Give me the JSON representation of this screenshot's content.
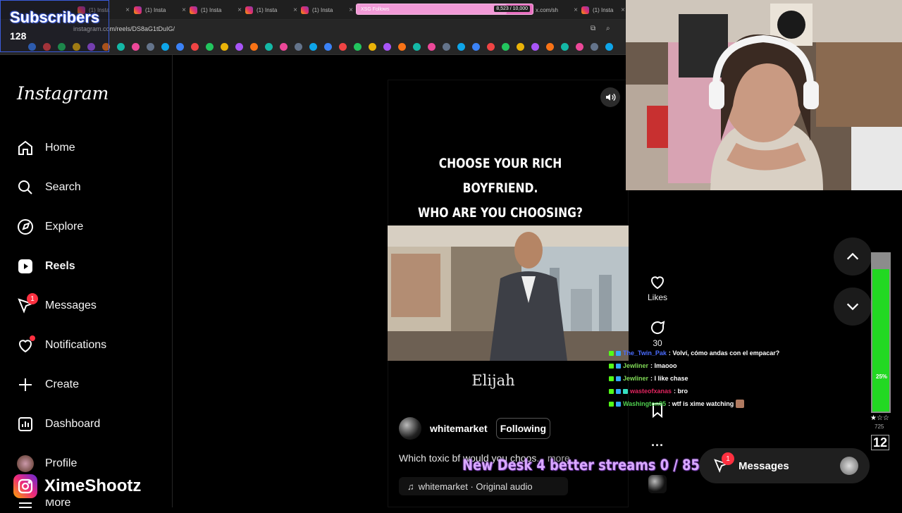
{
  "browser": {
    "tabs": [
      {
        "label": "(1) Insta"
      },
      {
        "label": "(1) Insta"
      },
      {
        "label": "(1) Insta"
      },
      {
        "label": "(1) Insta"
      },
      {
        "label": "(1) Insta"
      },
      {
        "label": "(1) Insta"
      },
      {
        "label": "(1) Insta"
      }
    ],
    "progress_tab": {
      "label": "XSG Follows",
      "count": "8,523 / 10,000",
      "fraction": 0.8523
    },
    "url": "instagram.com/reels/DS8aG1tDuIG/",
    "partial_tab_text": "x.com/sh"
  },
  "subscribers": {
    "title": "Subscribers",
    "count": "128"
  },
  "sidebar": {
    "logo": "Instagram",
    "items": [
      {
        "label": "Home",
        "icon": "home-icon"
      },
      {
        "label": "Search",
        "icon": "search-icon"
      },
      {
        "label": "Explore",
        "icon": "compass-icon"
      },
      {
        "label": "Reels",
        "icon": "reels-icon"
      },
      {
        "label": "Messages",
        "icon": "messenger-icon",
        "badge": "1"
      },
      {
        "label": "Notifications",
        "icon": "heart-icon"
      },
      {
        "label": "Create",
        "icon": "plus-icon"
      },
      {
        "label": "Dashboard",
        "icon": "dashboard-icon"
      },
      {
        "label": "Profile",
        "icon": "avatar"
      },
      {
        "label": "More",
        "icon": "menu-icon"
      }
    ]
  },
  "overlay_handle": "XimeShootz",
  "reel": {
    "headline_line1": "CHOOSE YOUR RICH BOYFRIEND.",
    "headline_line2": "WHO ARE YOU CHOOSING?",
    "name": "Elijah",
    "author": "whitemarket",
    "follow_label": "Following",
    "description": "Which toxic bf would you choos",
    "more": "... more",
    "audio": "whitemarket · Original audio"
  },
  "actions": {
    "likes_label": "Likes",
    "comments_count": "30"
  },
  "chat": [
    {
      "user": "The_Twin_Pak",
      "text": ": Volví, cómo andas con el empacar?",
      "color": "#4a6cff"
    },
    {
      "user": "Jewliner",
      "text": ": lmaooo",
      "color": "#7fd856"
    },
    {
      "user": "Jewliner",
      "text": ": I like chase",
      "color": "#7fd856"
    },
    {
      "user": "wasteofxanas",
      "text": ": bro",
      "color": "#e0245e"
    },
    {
      "user": "Washington95",
      "text": ": wtf is xime watching",
      "color": "#4fd14f"
    }
  ],
  "meter": {
    "label": "25%",
    "fraction": 0.9
  },
  "side_stats": {
    "stars": "★☆☆",
    "small": "725",
    "big": "12"
  },
  "goal": "New Desk 4 better streams  0 / 85",
  "messages_pill": {
    "label": "Messages",
    "badge": "1"
  },
  "colors": {
    "accent_red": "#ff3040",
    "meter_green": "#22d822",
    "goal_purple": "#d9a8ff"
  }
}
